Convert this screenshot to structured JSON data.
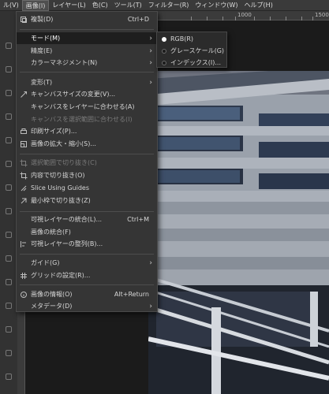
{
  "menubar": {
    "items": [
      {
        "label": "ル(V)"
      },
      {
        "label": "画像(I)"
      },
      {
        "label": "レイヤー(L)"
      },
      {
        "label": "色(C)"
      },
      {
        "label": "ツール(T)"
      },
      {
        "label": "フィルター(R)"
      },
      {
        "label": "ウィンドウ(W)"
      },
      {
        "label": "ヘルプ(H)"
      }
    ]
  },
  "ruler": {
    "top_labels": [
      "1000",
      "1500"
    ]
  },
  "image_menu": {
    "duplicate": {
      "label": "複製(D)",
      "shortcut": "Ctrl+D"
    },
    "mode": {
      "label": "モード(M)"
    },
    "precision": {
      "label": "精度(E)"
    },
    "color_management": {
      "label": "カラーマネジメント(N)"
    },
    "transform": {
      "label": "変形(T)"
    },
    "canvas_size": {
      "label": "キャンバスサイズの変更(V)..."
    },
    "fit_canvas_layers": {
      "label": "キャンバスをレイヤーに合わせる(A)"
    },
    "fit_canvas_selection": {
      "label": "キャンバスを選択範囲に合わせる(I)"
    },
    "print_size": {
      "label": "印刷サイズ(P)..."
    },
    "scale_image": {
      "label": "画像の拡大・縮小(S)..."
    },
    "crop_to_selection": {
      "label": "選択範囲で切り抜き(C)"
    },
    "crop_to_content": {
      "label": "内容で切り抜き(O)"
    },
    "slice_using_guides": {
      "label": "Slice Using Guides"
    },
    "zealous_crop": {
      "label": "最小枠で切り抜き(Z)"
    },
    "merge_visible": {
      "label": "可視レイヤーの統合(L)...",
      "shortcut": "Ctrl+M"
    },
    "flatten": {
      "label": "画像の統合(F)"
    },
    "align_visible": {
      "label": "可視レイヤーの整列(B)..."
    },
    "guides": {
      "label": "ガイド(G)"
    },
    "configure_grid": {
      "label": "グリッドの設定(R)..."
    },
    "image_properties": {
      "label": "画像の情報(O)",
      "shortcut": "Alt+Return"
    },
    "metadata": {
      "label": "メタデータ(D)"
    }
  },
  "mode_submenu": {
    "items": [
      {
        "label": "RGB(R)",
        "selected": true
      },
      {
        "label": "グレースケール(G)",
        "selected": false
      },
      {
        "label": "インデックス(I)...",
        "selected": false
      }
    ]
  },
  "colors": {
    "menu_bg": "#353535",
    "highlight_bg": "#1e1e1e",
    "menubar_bg": "#3a3a3a",
    "disabled_text": "#7a7a7a"
  }
}
